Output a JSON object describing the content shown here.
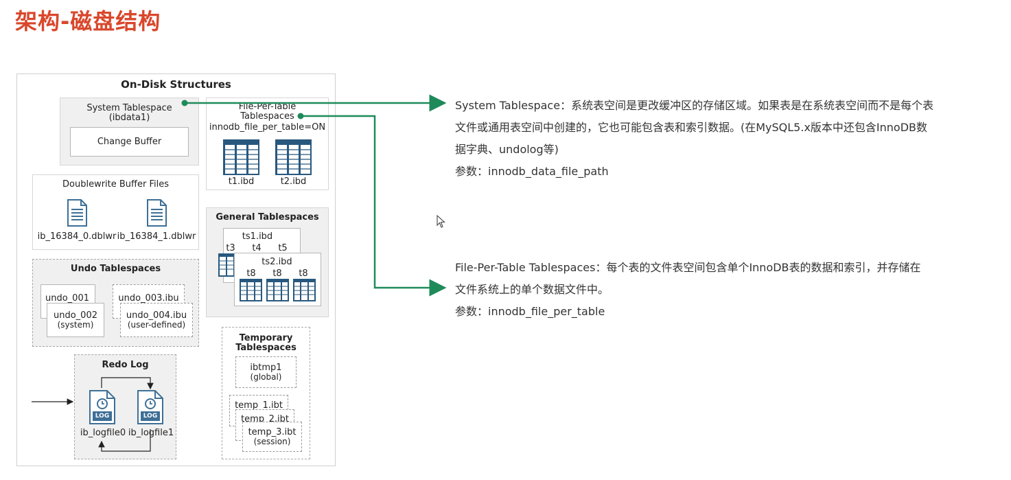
{
  "title": "架构-磁盘结构",
  "diagram": {
    "title": "On-Disk Structures",
    "system_tablespace": {
      "title_line1": "System Tablespace",
      "title_line2": "(ibdata1)",
      "change_buffer": "Change Buffer"
    },
    "file_per_table": {
      "title_line1": "File-Per-Table",
      "title_line2": "Tablespaces",
      "setting": "innodb_file_per_table=ON",
      "files": [
        "t1.ibd",
        "t2.ibd"
      ]
    },
    "doublewrite": {
      "title": "Doublewrite Buffer Files",
      "files": [
        "ib_16384_0.dblwr",
        "ib_16384_1.dblwr"
      ]
    },
    "general_tablespaces": {
      "title": "General Tablespaces",
      "ts1": "ts1.ibd",
      "ts1_tables": [
        "t3",
        "t4",
        "t5"
      ],
      "ts2": "ts2.ibd",
      "ts2_tables": [
        "t8",
        "t8",
        "t8"
      ]
    },
    "undo_tablespaces": {
      "title": "Undo Tablespaces",
      "undo_001": "undo_001",
      "undo_002": "undo_002",
      "undo_002_note": "(system)",
      "undo_003": "undo_003.ibu",
      "undo_004": "undo_004.ibu",
      "undo_004_note": "(user-defined)"
    },
    "temporary_tablespaces": {
      "title_line1": "Temporary",
      "title_line2": "Tablespaces",
      "ibtmp1": "ibtmp1",
      "ibtmp1_note": "(global)",
      "temp1": "temp_1.ibt",
      "temp2": "temp_2.ibt",
      "temp3": "temp_3.ibt",
      "temp3_note": "(session)"
    },
    "redo_log": {
      "title": "Redo Log",
      "log_badge": "LOG",
      "files": [
        "ib_logfile0",
        "ib_logfile1"
      ]
    }
  },
  "descriptions": {
    "system": {
      "line1": "System Tablespace：系统表空间是更改缓冲区的存储区域。如果表是在系统表空间而不是每个表",
      "line2": "文件或通用表空间中创建的，它也可能包含表和索引数据。(在MySQL5.x版本中还包含InnoDB数",
      "line3": "据字典、undolog等)",
      "param": "参数：innodb_data_file_path"
    },
    "file_per_table": {
      "line1": "File-Per-Table Tablespaces：每个表的文件表空间包含单个InnoDB表的数据和索引，并存储在",
      "line2": "文件系统上的单个数据文件中。",
      "param": "参数：innodb_file_per_table"
    }
  },
  "colors": {
    "title": "#d9472b",
    "connector": "#1e8a5a",
    "icon_blue": "#3d6f96",
    "table_header": "#28587e"
  }
}
